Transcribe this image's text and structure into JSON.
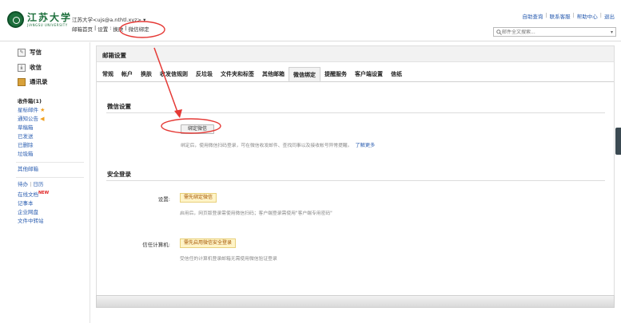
{
  "header": {
    "logo_cn": "江苏大学",
    "logo_en": "JIANGSU UNIVERSITY",
    "user_line": "江苏大学<ujs@a.nthtl.xyz> ▾",
    "crumb": {
      "home": "邮箱首页",
      "sep1": "|",
      "settings": "设置",
      "sep2": ":",
      "skin": "换肤",
      "sep3": "|",
      "current": "微信绑定"
    },
    "top_links": [
      "自助查询",
      "联系客服",
      "帮助中心",
      "退出"
    ],
    "search_placeholder": "邮件全文搜索..."
  },
  "sidebar": {
    "write": "写信",
    "receive": "收信",
    "contacts": "通讯录",
    "folders": {
      "inbox": "收件箱(1)",
      "starred": "星标邮件",
      "notice": "通知公告",
      "drafts": "草稿箱",
      "sent": "已发送",
      "deleted": "已删除",
      "spam": "垃圾箱",
      "other": "其他邮箱",
      "todo": "待办",
      "todo_sep": "|",
      "calendar": "日历",
      "docs": "在线文档",
      "new_badge": "NEW",
      "notes": "记事本",
      "netdisk": "企业网盘",
      "transfer": "文件中转站"
    }
  },
  "main": {
    "title": "邮箱设置",
    "tabs": [
      "常规",
      "帐户",
      "换肤",
      "收发信规则",
      "反垃圾",
      "文件夹和标签",
      "其他邮箱",
      "微信绑定",
      "提醒服务",
      "客户端设置",
      "信纸"
    ],
    "active_tab": "微信绑定",
    "wechat_section": {
      "title": "微信设置",
      "bind_button": "绑定微信",
      "hint": "绑定后，使用微信扫码登录，可在微信收发邮件、查找同事以及接收帐号异常提醒。",
      "learn_more": "了解更多"
    },
    "security_section": {
      "title": "安全登录",
      "setting_label": "设置:",
      "setting_badge": "需先绑定微信",
      "setting_hint": "启用后，网页版登录需使用微信扫码；客户端登录需使用\"客户端专用密码\"",
      "trusted_label": "信任计算机:",
      "trusted_badge": "需先启用微信安全登录",
      "trusted_hint": "受信任的计算机登录邮箱无需使用微信验证登录"
    }
  },
  "colors": {
    "annotation": "#e53935",
    "link": "#2a5db0",
    "brand": "#1d6f3c"
  }
}
